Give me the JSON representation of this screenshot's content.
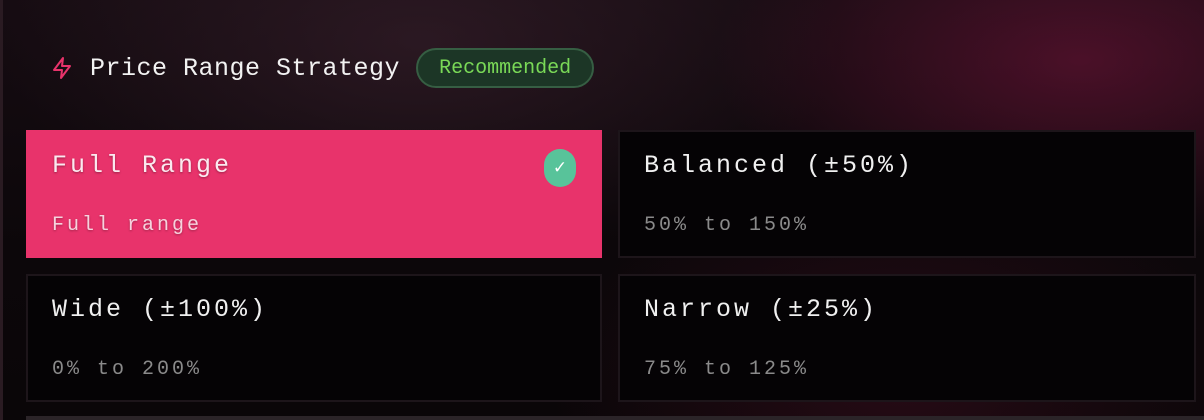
{
  "header": {
    "icon": "lightning-icon",
    "title": "Price Range Strategy",
    "badge": "Recommended"
  },
  "colors": {
    "accent": "#e8336b",
    "badge_text": "#7ad957",
    "badge_bg": "#1c3626",
    "check_bg": "#58c39a",
    "card_bg": "#050305"
  },
  "options": [
    {
      "title": "Full Range",
      "subtitle": "Full range",
      "selected": true
    },
    {
      "title": "Balanced (±50%)",
      "subtitle": "50% to 150%",
      "selected": false
    },
    {
      "title": "Wide (±100%)",
      "subtitle": "0% to 200%",
      "selected": false
    },
    {
      "title": "Narrow (±25%)",
      "subtitle": "75% to 125%",
      "selected": false
    }
  ],
  "selected_check_glyph": "✓"
}
